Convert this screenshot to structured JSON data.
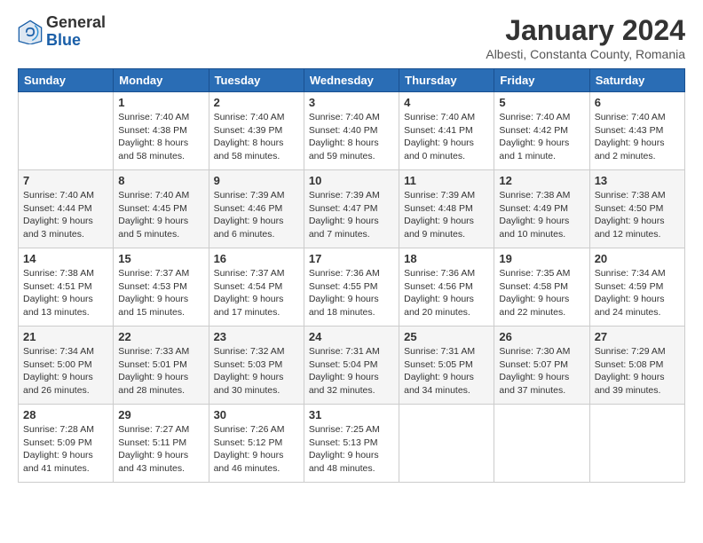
{
  "header": {
    "logo_general": "General",
    "logo_blue": "Blue",
    "month_year": "January 2024",
    "location": "Albesti, Constanta County, Romania"
  },
  "days_of_week": [
    "Sunday",
    "Monday",
    "Tuesday",
    "Wednesday",
    "Thursday",
    "Friday",
    "Saturday"
  ],
  "weeks": [
    [
      {
        "day": "",
        "sunrise": "",
        "sunset": "",
        "daylight": ""
      },
      {
        "day": "1",
        "sunrise": "Sunrise: 7:40 AM",
        "sunset": "Sunset: 4:38 PM",
        "daylight": "Daylight: 8 hours and 58 minutes."
      },
      {
        "day": "2",
        "sunrise": "Sunrise: 7:40 AM",
        "sunset": "Sunset: 4:39 PM",
        "daylight": "Daylight: 8 hours and 58 minutes."
      },
      {
        "day": "3",
        "sunrise": "Sunrise: 7:40 AM",
        "sunset": "Sunset: 4:40 PM",
        "daylight": "Daylight: 8 hours and 59 minutes."
      },
      {
        "day": "4",
        "sunrise": "Sunrise: 7:40 AM",
        "sunset": "Sunset: 4:41 PM",
        "daylight": "Daylight: 9 hours and 0 minutes."
      },
      {
        "day": "5",
        "sunrise": "Sunrise: 7:40 AM",
        "sunset": "Sunset: 4:42 PM",
        "daylight": "Daylight: 9 hours and 1 minute."
      },
      {
        "day": "6",
        "sunrise": "Sunrise: 7:40 AM",
        "sunset": "Sunset: 4:43 PM",
        "daylight": "Daylight: 9 hours and 2 minutes."
      }
    ],
    [
      {
        "day": "7",
        "sunrise": "Sunrise: 7:40 AM",
        "sunset": "Sunset: 4:44 PM",
        "daylight": "Daylight: 9 hours and 3 minutes."
      },
      {
        "day": "8",
        "sunrise": "Sunrise: 7:40 AM",
        "sunset": "Sunset: 4:45 PM",
        "daylight": "Daylight: 9 hours and 5 minutes."
      },
      {
        "day": "9",
        "sunrise": "Sunrise: 7:39 AM",
        "sunset": "Sunset: 4:46 PM",
        "daylight": "Daylight: 9 hours and 6 minutes."
      },
      {
        "day": "10",
        "sunrise": "Sunrise: 7:39 AM",
        "sunset": "Sunset: 4:47 PM",
        "daylight": "Daylight: 9 hours and 7 minutes."
      },
      {
        "day": "11",
        "sunrise": "Sunrise: 7:39 AM",
        "sunset": "Sunset: 4:48 PM",
        "daylight": "Daylight: 9 hours and 9 minutes."
      },
      {
        "day": "12",
        "sunrise": "Sunrise: 7:38 AM",
        "sunset": "Sunset: 4:49 PM",
        "daylight": "Daylight: 9 hours and 10 minutes."
      },
      {
        "day": "13",
        "sunrise": "Sunrise: 7:38 AM",
        "sunset": "Sunset: 4:50 PM",
        "daylight": "Daylight: 9 hours and 12 minutes."
      }
    ],
    [
      {
        "day": "14",
        "sunrise": "Sunrise: 7:38 AM",
        "sunset": "Sunset: 4:51 PM",
        "daylight": "Daylight: 9 hours and 13 minutes."
      },
      {
        "day": "15",
        "sunrise": "Sunrise: 7:37 AM",
        "sunset": "Sunset: 4:53 PM",
        "daylight": "Daylight: 9 hours and 15 minutes."
      },
      {
        "day": "16",
        "sunrise": "Sunrise: 7:37 AM",
        "sunset": "Sunset: 4:54 PM",
        "daylight": "Daylight: 9 hours and 17 minutes."
      },
      {
        "day": "17",
        "sunrise": "Sunrise: 7:36 AM",
        "sunset": "Sunset: 4:55 PM",
        "daylight": "Daylight: 9 hours and 18 minutes."
      },
      {
        "day": "18",
        "sunrise": "Sunrise: 7:36 AM",
        "sunset": "Sunset: 4:56 PM",
        "daylight": "Daylight: 9 hours and 20 minutes."
      },
      {
        "day": "19",
        "sunrise": "Sunrise: 7:35 AM",
        "sunset": "Sunset: 4:58 PM",
        "daylight": "Daylight: 9 hours and 22 minutes."
      },
      {
        "day": "20",
        "sunrise": "Sunrise: 7:34 AM",
        "sunset": "Sunset: 4:59 PM",
        "daylight": "Daylight: 9 hours and 24 minutes."
      }
    ],
    [
      {
        "day": "21",
        "sunrise": "Sunrise: 7:34 AM",
        "sunset": "Sunset: 5:00 PM",
        "daylight": "Daylight: 9 hours and 26 minutes."
      },
      {
        "day": "22",
        "sunrise": "Sunrise: 7:33 AM",
        "sunset": "Sunset: 5:01 PM",
        "daylight": "Daylight: 9 hours and 28 minutes."
      },
      {
        "day": "23",
        "sunrise": "Sunrise: 7:32 AM",
        "sunset": "Sunset: 5:03 PM",
        "daylight": "Daylight: 9 hours and 30 minutes."
      },
      {
        "day": "24",
        "sunrise": "Sunrise: 7:31 AM",
        "sunset": "Sunset: 5:04 PM",
        "daylight": "Daylight: 9 hours and 32 minutes."
      },
      {
        "day": "25",
        "sunrise": "Sunrise: 7:31 AM",
        "sunset": "Sunset: 5:05 PM",
        "daylight": "Daylight: 9 hours and 34 minutes."
      },
      {
        "day": "26",
        "sunrise": "Sunrise: 7:30 AM",
        "sunset": "Sunset: 5:07 PM",
        "daylight": "Daylight: 9 hours and 37 minutes."
      },
      {
        "day": "27",
        "sunrise": "Sunrise: 7:29 AM",
        "sunset": "Sunset: 5:08 PM",
        "daylight": "Daylight: 9 hours and 39 minutes."
      }
    ],
    [
      {
        "day": "28",
        "sunrise": "Sunrise: 7:28 AM",
        "sunset": "Sunset: 5:09 PM",
        "daylight": "Daylight: 9 hours and 41 minutes."
      },
      {
        "day": "29",
        "sunrise": "Sunrise: 7:27 AM",
        "sunset": "Sunset: 5:11 PM",
        "daylight": "Daylight: 9 hours and 43 minutes."
      },
      {
        "day": "30",
        "sunrise": "Sunrise: 7:26 AM",
        "sunset": "Sunset: 5:12 PM",
        "daylight": "Daylight: 9 hours and 46 minutes."
      },
      {
        "day": "31",
        "sunrise": "Sunrise: 7:25 AM",
        "sunset": "Sunset: 5:13 PM",
        "daylight": "Daylight: 9 hours and 48 minutes."
      },
      {
        "day": "",
        "sunrise": "",
        "sunset": "",
        "daylight": ""
      },
      {
        "day": "",
        "sunrise": "",
        "sunset": "",
        "daylight": ""
      },
      {
        "day": "",
        "sunrise": "",
        "sunset": "",
        "daylight": ""
      }
    ]
  ]
}
